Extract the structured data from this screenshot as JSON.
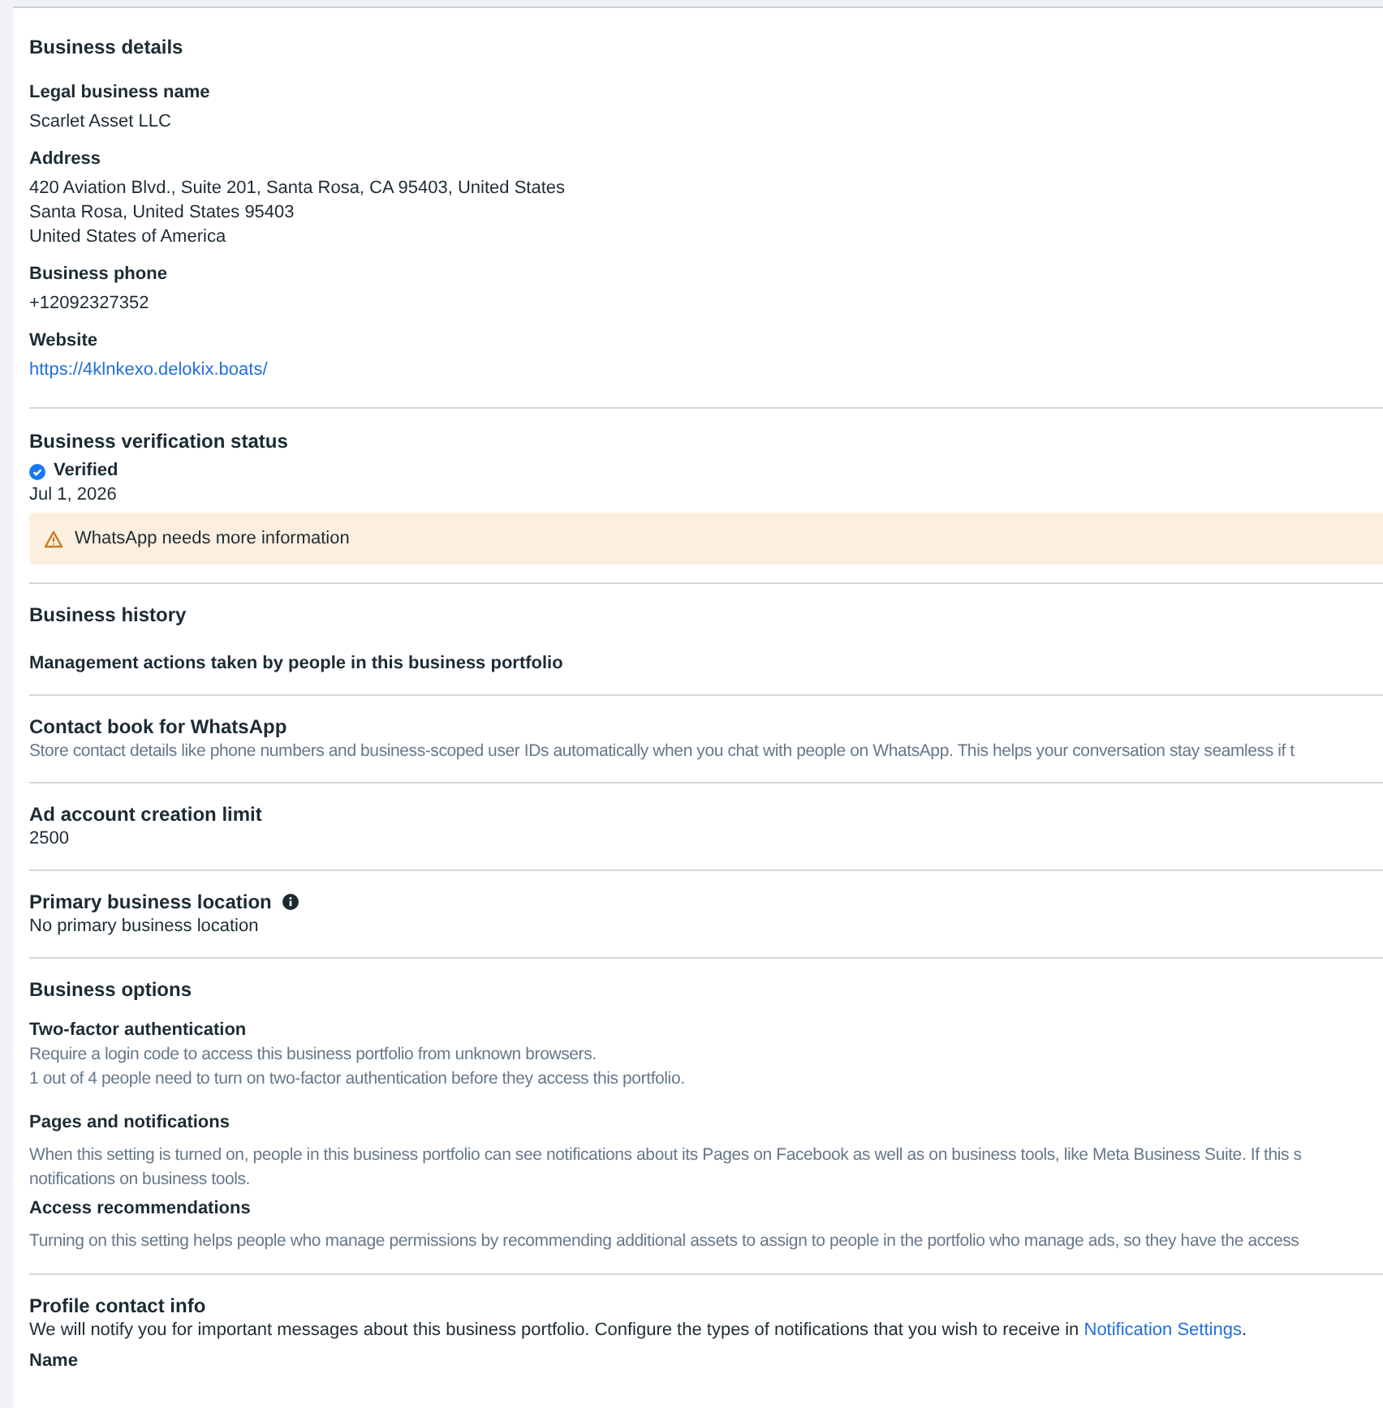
{
  "sections": [
    {
      "kind": "details",
      "title": "Business details",
      "fields": [
        {
          "label": "Legal business name",
          "lines": [
            "Scarlet Asset LLC"
          ]
        },
        {
          "label": "Address",
          "lines": [
            "420 Aviation Blvd., Suite 201, Santa Rosa, CA 95403, United States",
            "Santa Rosa, United States 95403",
            "United States of America"
          ]
        },
        {
          "label": "Business phone",
          "lines": [
            "+12092327352"
          ]
        },
        {
          "label": "Website",
          "link": "https://4klnkexo.delokix.boats/"
        }
      ]
    },
    {
      "kind": "verification",
      "title": "Business verification status",
      "status": "Verified",
      "verified": true,
      "date": "Jul 1, 2026",
      "alert": "WhatsApp needs more information"
    },
    {
      "kind": "history",
      "title": "Business history",
      "subtitle": "Management actions taken by people in this business portfolio"
    },
    {
      "kind": "simple",
      "title": "Contact book for WhatsApp",
      "text": "Store contact details like phone numbers and business-scoped user IDs automatically when you chat with people on WhatsApp. This helps your conversation stay seamless if t",
      "muted": true,
      "info": false
    },
    {
      "kind": "simple",
      "title": "Ad account creation limit",
      "text": "2500",
      "muted": false,
      "info": false
    },
    {
      "kind": "simple",
      "title": "Primary business location",
      "text": "No primary business location",
      "muted": false,
      "info": true
    },
    {
      "kind": "options",
      "title": "Business options",
      "options": [
        {
          "label": "Two-factor authentication",
          "lines": [
            "Require a login code to access this business portfolio from unknown browsers.",
            "1 out of 4 people need to turn on two-factor authentication before they access this portfolio."
          ]
        },
        {
          "label": "Pages and notifications",
          "lines": [
            "When this setting is turned on, people in this business portfolio can see notifications about its Pages on Facebook as well as on business tools, like Meta Business Suite. If this s",
            "notifications on business tools."
          ]
        },
        {
          "label": "Access recommendations",
          "lines": [
            "Turning on this setting helps people who manage permissions by recommending additional assets to assign to people in the portfolio who manage ads, so they have the access"
          ]
        }
      ]
    },
    {
      "kind": "contact",
      "title": "Profile contact info",
      "text": "We will notify you for important messages about this business portfolio. Configure the types of notifications that you wish to receive in ",
      "link": "Notification Settings",
      "after": ".",
      "fields": [
        {
          "label": "Name"
        }
      ]
    }
  ]
}
